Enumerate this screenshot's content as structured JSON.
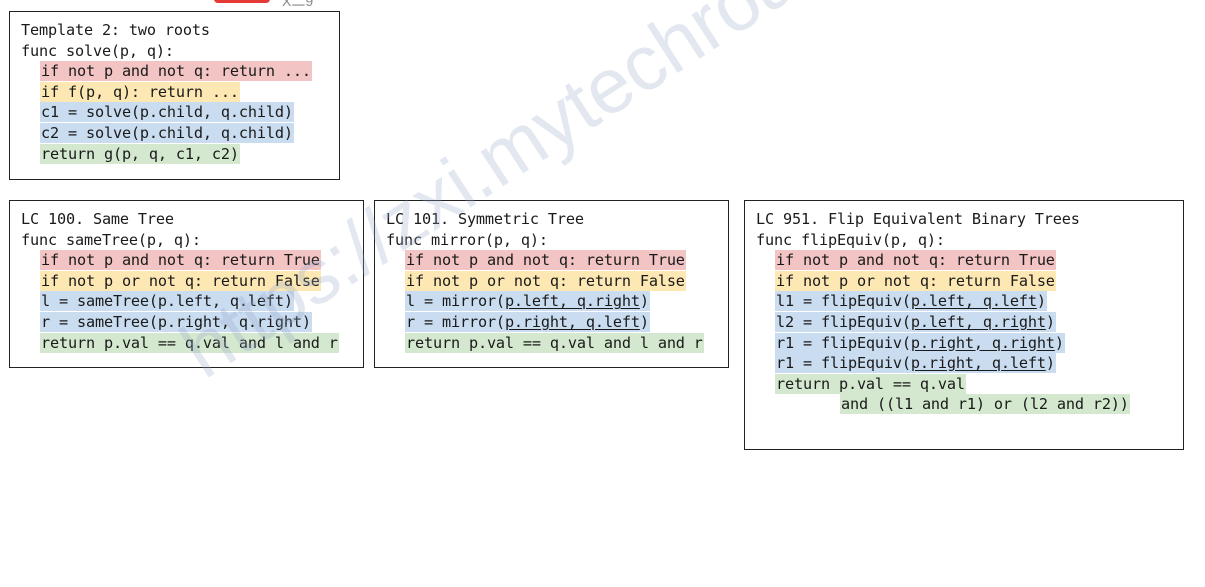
{
  "header": {
    "partial_text": "X二9"
  },
  "watermark": {
    "text": "https://zxi.mytechroad.com/blog/"
  },
  "boxes": {
    "template": {
      "title": "Template 2: two roots",
      "signature": "func solve(p, q):",
      "lines": [
        "if not p and not q: return ...",
        "if f(p, q): return ...",
        "c1 = solve(p.child, q.child)",
        "c2 = solve(p.child, q.child)",
        "return g(p, q, c1, c2)"
      ]
    },
    "same_tree": {
      "title": "LC 100. Same Tree",
      "signature": "func sameTree(p, q):",
      "lines": [
        "if not p and not q: return True",
        "if not p or not q: return False",
        "l = sameTree(p.left, q.left)",
        "r = sameTree(p.right, q.right)",
        "return p.val == q.val and l and r"
      ]
    },
    "symmetric_tree": {
      "title": "LC 101. Symmetric Tree",
      "signature": "func mirror(p, q):",
      "lines": [
        "if not p and not q: return True",
        "if not p or not q: return False"
      ],
      "l_prefix": "l = mirror(",
      "l_args": "p.left, q.right",
      "r_prefix": "r = mirror(",
      "r_args": "p.right, q.left",
      "call_suffix": ")",
      "return_line": "return p.val == q.val and l and r"
    },
    "flip_equiv": {
      "title": "LC 951. Flip Equivalent Binary Trees",
      "signature": "func flipEquiv(p, q):",
      "lines": [
        "if not p and not q: return True",
        "if not p or not q: return False"
      ],
      "calls": [
        {
          "prefix": "l1 = flipEquiv(",
          "args": "p.left, q.left"
        },
        {
          "prefix": "l2 = flipEquiv(",
          "args": "p.left, q.right"
        },
        {
          "prefix": "r1 = flipEquiv(",
          "args": "p.right, q.right"
        },
        {
          "prefix": "r1 = flipEquiv(",
          "args": "p.right, q.left"
        }
      ],
      "call_suffix": ")",
      "return_line1": "return p.val == q.val",
      "return_line2": "and ((l1 and r1) or (l2 and r2))"
    }
  },
  "colors": {
    "base_case_empty": "#f3c4c4",
    "base_case_mismatch": "#fde8b4",
    "recursive_call": "#c9dcf0",
    "combine": "#d3e8ce"
  }
}
